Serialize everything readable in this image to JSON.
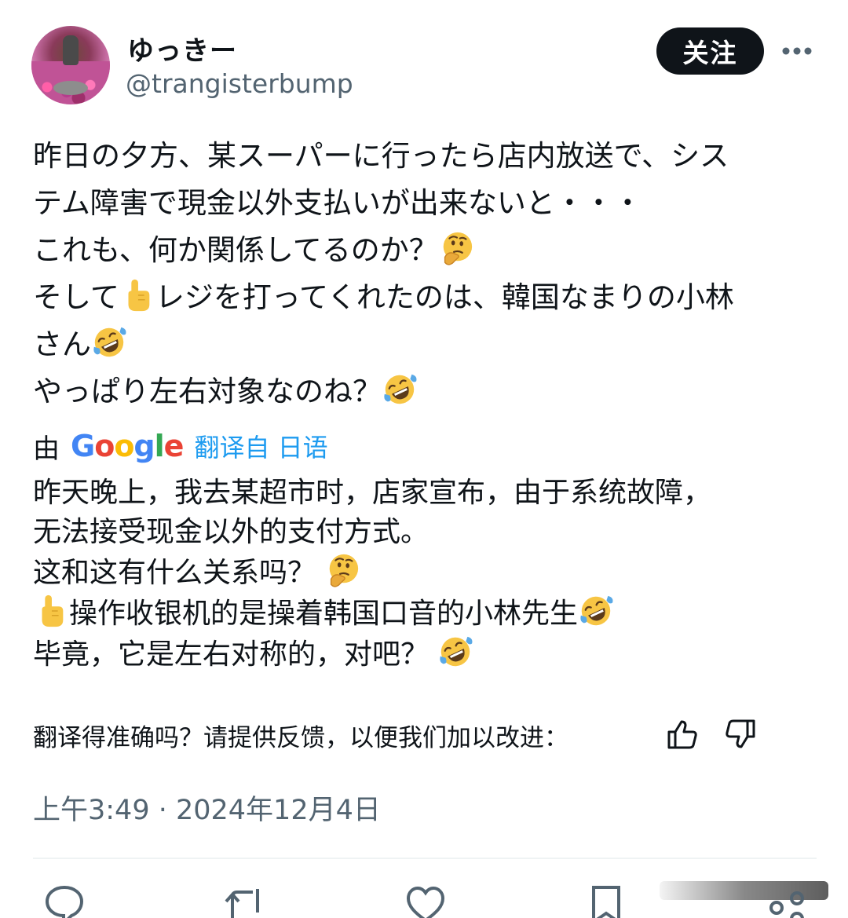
{
  "user": {
    "display_name": "ゆっきー",
    "handle": "@trangisterbump"
  },
  "header": {
    "follow_label": "关注"
  },
  "tweet": {
    "original_lines": [
      "昨日の夕方、某スーパーに行ったら店内放送で、シス",
      "テム障害で現金以外支払いが出来ないと・・・",
      "これも、何か関係してるのか？",
      "そして",
      "レジを打ってくれたのは、韓国なまりの小林",
      "さん",
      "やっぱり左右対象なのね？"
    ],
    "translation_prefix": "由",
    "translation_provider": "Google",
    "translated_from": "翻译自 日语",
    "translated_lines": [
      "昨天晚上，我去某超市时，店家宣布，由于系统故障，",
      "无法接受现金以外的支付方式。",
      "这和这有什么关系吗？",
      "操作收银机的是操着韩国口音的小林先生",
      "毕竟，它是左右对称的，对吧？"
    ],
    "feedback_prompt": "翻译得准确吗？请提供反馈，以便我们加以改进：",
    "timestamp": "上午3:49 · 2024年12月4日"
  },
  "icons": {
    "more": "more-dots-icon",
    "reply": "reply-icon",
    "retweet": "retweet-icon",
    "like": "heart-icon",
    "bookmark": "bookmark-icon",
    "share": "share-icon",
    "thumbs_up": "thumbs-up-icon",
    "thumbs_down": "thumbs-down-icon"
  },
  "colors": {
    "text": "#0f1419",
    "secondary": "#536471",
    "link": "#1d9bf0",
    "button_bg": "#0f1419",
    "emoji_yellow": "#f7c544"
  }
}
